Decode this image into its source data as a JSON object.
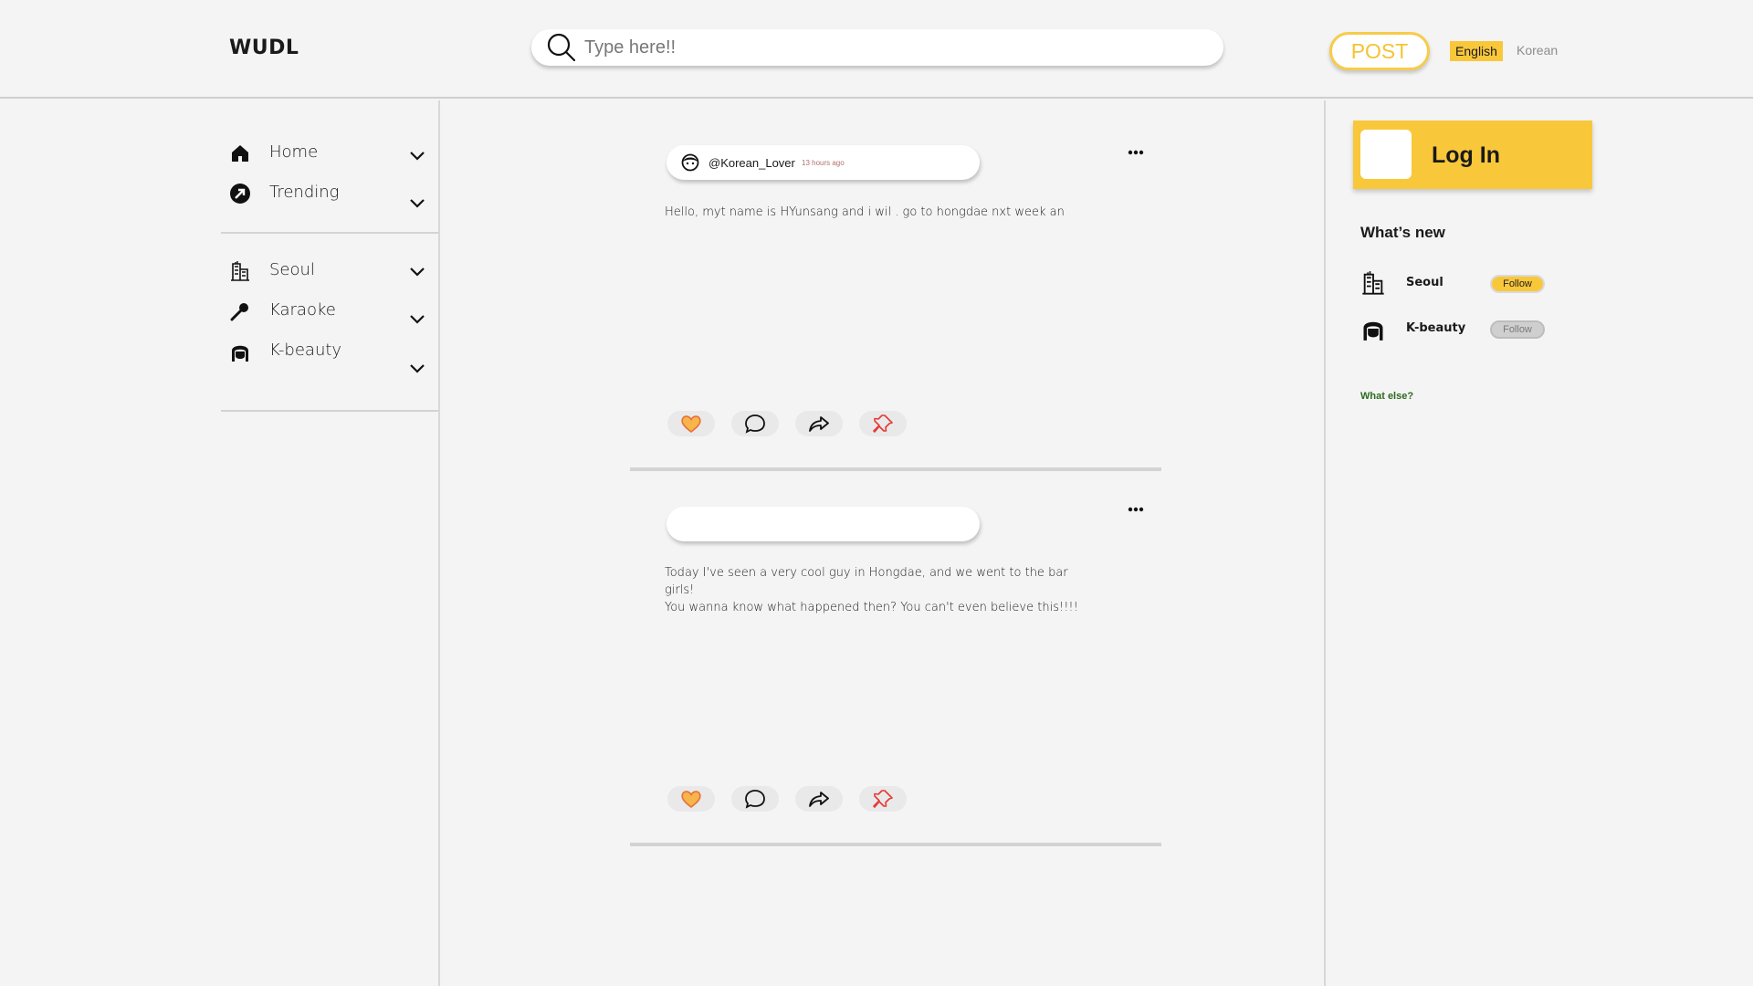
{
  "header": {
    "logo": "WUDL",
    "search_placeholder": "Type here!!",
    "post_label": "POST",
    "languages": [
      {
        "label": "English",
        "active": true
      },
      {
        "label": "Korean",
        "active": false
      }
    ]
  },
  "sidebar": {
    "main_items": [
      {
        "label": "Home",
        "icon": "home-icon"
      },
      {
        "label": "Trending",
        "icon": "trending-icon"
      }
    ],
    "topic_items": [
      {
        "label": "Seoul",
        "icon": "city-icon"
      },
      {
        "label": "Karaoke",
        "icon": "microphone-icon"
      },
      {
        "label": "K-beauty",
        "icon": "face-icon"
      }
    ]
  },
  "feed": {
    "posts": [
      {
        "username": "@Korean_Lover",
        "time": "13 hours ago",
        "text_lines": [
          "Hello, myt name is HYunsang and i wil . go to hongdae nxt week an"
        ]
      },
      {
        "username": "",
        "time": "",
        "text_lines": [
          "Today I've seen a very cool guy in Hongdae, and we went to the bar girls!",
          "You wanna know what happened then? You can't even believe this!!!!"
        ]
      }
    ],
    "actions": [
      "heart-icon",
      "comment-icon",
      "share-icon",
      "pin-icon"
    ]
  },
  "right_panel": {
    "login_label": "Log In",
    "whats_new_title": "What’s new",
    "items": [
      {
        "label": "Seoul",
        "icon": "city-icon",
        "follow_label": "Follow",
        "following": true
      },
      {
        "label": "K-beauty",
        "icon": "face-icon",
        "follow_label": "Follow",
        "following": false
      }
    ],
    "what_else": "What else?"
  },
  "colors": {
    "accent": "#f9c73a",
    "background": "#f4f4f4",
    "heart": "#f08a4b",
    "pin": "#e53935",
    "link_green": "#2d6a1f"
  }
}
